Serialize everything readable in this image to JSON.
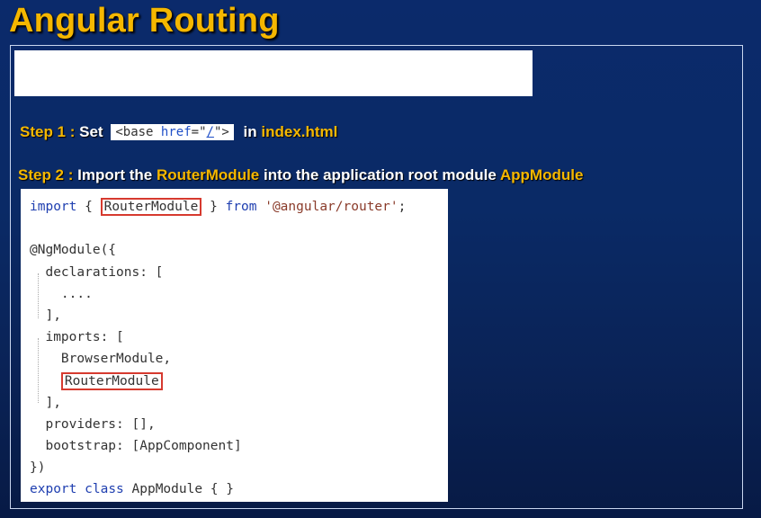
{
  "title": "Angular Routing",
  "step1": {
    "label": "Step 1 :",
    "text_before": "Set",
    "code_tag_open": "<base ",
    "code_attr": "href",
    "code_eq": "=\"",
    "code_value": "/",
    "code_tag_close": "\">",
    "text_in": "in",
    "file": "index.html"
  },
  "step2": {
    "label": "Step 2 :",
    "text1": "Import the",
    "module": "RouterModule",
    "text2": "into the application root module",
    "root_module": "AppModule"
  },
  "code": {
    "l1_kw": "import",
    "l1_a": " { ",
    "l1_boxed": "RouterModule",
    "l1_b": " } ",
    "l1_from": "from",
    "l1_sp": " ",
    "l1_str": "'@angular/router'",
    "l1_end": ";",
    "l3": "@NgModule({",
    "l4": "  declarations: [",
    "l5": "    ....",
    "l6": "  ],",
    "l7": "  imports: [",
    "l8": "    BrowserModule,",
    "l9_indent": "    ",
    "l9_boxed": "RouterModule",
    "l10": "  ],",
    "l11": "  providers: [],",
    "l12": "  bootstrap: [AppComponent]",
    "l13": "})",
    "l14_kw": "export",
    "l14_sp": " ",
    "l14_kw2": "class",
    "l14_rest": " AppModule { }"
  }
}
